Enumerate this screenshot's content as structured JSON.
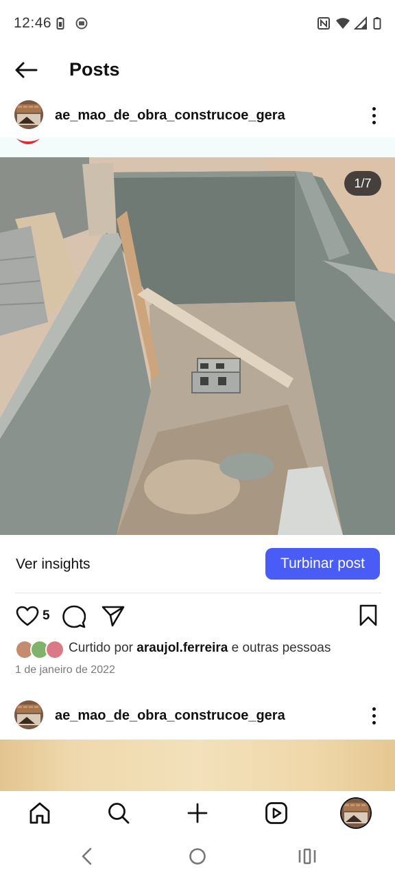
{
  "status_bar": {
    "time": "12:46",
    "left_icons": [
      "battery-saver-icon",
      "notification-app-icon"
    ],
    "right_icons": [
      "nfc-icon",
      "wifi-icon",
      "cell-signal-icon",
      "battery-icon"
    ]
  },
  "header": {
    "back_icon": "arrow-left-icon",
    "title": "Posts"
  },
  "post": {
    "username": "ae_mao_de_obra_construcoe_gera",
    "more_icon": "more-vertical-icon",
    "image_counter": "1/7",
    "image_description_icon": "construction-photo",
    "insights_label": "Ver insights",
    "boost_label": "Turbinar post",
    "like_count": "5",
    "liked_prefix": "Curtido por ",
    "liked_user": "araujol.ferreira",
    "liked_suffix": " e outras pessoas",
    "date": "1 de janeiro de 2022",
    "action_icons": [
      "heart-icon",
      "comment-icon",
      "share-icon",
      "bookmark-icon"
    ]
  },
  "next_post": {
    "username": "ae_mao_de_obra_construcoe_gera"
  },
  "bottom_nav": {
    "items": [
      "home-icon",
      "search-icon",
      "create-icon",
      "reels-icon",
      "profile-avatar"
    ]
  },
  "system_nav": {
    "items": [
      "system-back-icon",
      "system-home-icon",
      "system-recents-icon"
    ]
  },
  "colors": {
    "accent": "#4a5cf6",
    "text": "#111111",
    "muted": "#7a7a7a",
    "strip": "#f3fbfb"
  }
}
